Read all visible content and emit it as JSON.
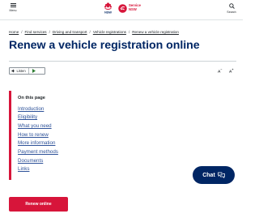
{
  "header": {
    "menu_label": "Menu",
    "search_label": "Search",
    "logo_nsw_text": "NSW",
    "service_nsw_line1": "Service",
    "service_nsw_line2": "NSW"
  },
  "breadcrumb": [
    {
      "label": "Home"
    },
    {
      "label": "Find services"
    },
    {
      "label": "Driving and transport"
    },
    {
      "label": "Vehicle registrations"
    },
    {
      "label": "Renew a vehicle registration"
    }
  ],
  "page_title": "Renew a vehicle registration online",
  "listen": {
    "label": "Listen"
  },
  "text_size": {
    "decrease": "A",
    "increase": "A",
    "decrease_sign": "−",
    "increase_sign": "+"
  },
  "on_this_page": {
    "heading": "On this page",
    "links": [
      {
        "label": "Introduction"
      },
      {
        "label": "Eligibility"
      },
      {
        "label": "What you need"
      },
      {
        "label": "How to renew"
      },
      {
        "label": "More information"
      },
      {
        "label": "Payment methods"
      },
      {
        "label": "Documents"
      },
      {
        "label": "Links"
      }
    ]
  },
  "chat": {
    "label": "Chat"
  },
  "primary_action": {
    "label": "Renew online"
  },
  "colors": {
    "brand_navy": "#002664",
    "brand_red": "#d7153a",
    "link_blue": "#2e5299"
  }
}
